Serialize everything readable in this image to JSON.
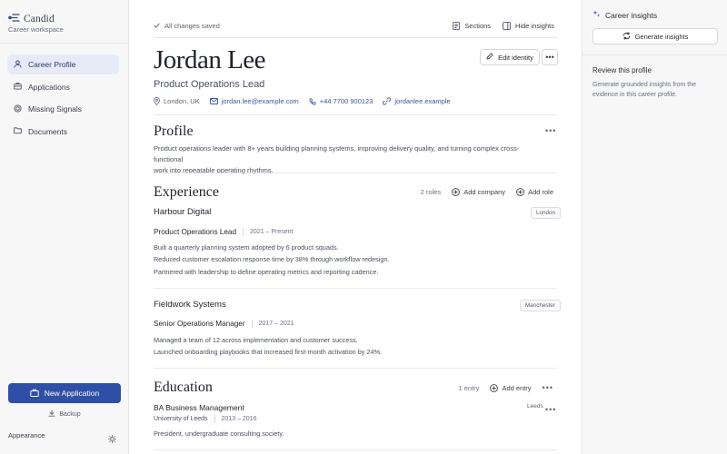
{
  "sidebar": {
    "brand": "Candid",
    "workspace": "Career workspace",
    "items": [
      {
        "label": "Career Profile",
        "icon": "user-icon",
        "active": true
      },
      {
        "label": "Applications",
        "icon": "briefcase-icon",
        "active": false
      },
      {
        "label": "Missing Signals",
        "icon": "target-icon",
        "active": false
      },
      {
        "label": "Documents",
        "icon": "folder-icon",
        "active": false
      }
    ],
    "new_application": "New Application",
    "backup": "Backup",
    "appearance": "Appearance"
  },
  "toolbar": {
    "saved_status": "All changes saved",
    "sections": "Sections",
    "hide_insights": "Hide insights"
  },
  "profile_header": {
    "name": "Jordan Lee",
    "role": "Product Operations Lead",
    "edit_identity": "Edit identity",
    "location": "London, UK",
    "email": "jordan.lee@example.com",
    "phone": "+44 7700 900123",
    "website": "jordanlee.example"
  },
  "profile": {
    "title": "Profile",
    "summary_line1": "Product operations leader with 8+ years building planning systems, improving delivery quality, and turning complex cross-functional",
    "summary_line2": "work into repeatable operating rhythms."
  },
  "experience": {
    "title": "Experience",
    "count": "2 roles",
    "add_company": "Add company",
    "add_role": "Add role",
    "companies": [
      {
        "name": "Harbour Digital",
        "location": "London",
        "role": "Product Operations Lead",
        "dates": "2021 – Present",
        "bullets": [
          "Built a quarterly planning system adopted by 6 product squads.",
          "Reduced customer escalation response time by 38% through workflow redesign.",
          "Partnered with leadership to define operating metrics and reporting cadence."
        ]
      },
      {
        "name": "Fieldwork Systems",
        "location": "Manchester",
        "role": "Senior Operations Manager",
        "dates": "2017 – 2021",
        "bullets": [
          "Managed a team of 12 across implementation and customer success.",
          "Launched onboarding playbooks that increased first-month activation by 24%."
        ]
      }
    ]
  },
  "education": {
    "title": "Education",
    "count": "1 entry",
    "add_entry": "Add entry",
    "degree": "BA Business Management",
    "school": "University of Leeds",
    "dates": "2013 – 2016",
    "location": "Leeds",
    "note": "President, undergraduate consulting society."
  },
  "insights": {
    "title": "Career insights",
    "generate": "Generate insights",
    "review_title": "Review this profile",
    "review_text": "Generate grounded insights from the evidence in this career profile."
  },
  "colors": {
    "accent": "#2f4fa6",
    "active_nav": "#e6ebf7",
    "link": "#3a55a8"
  }
}
